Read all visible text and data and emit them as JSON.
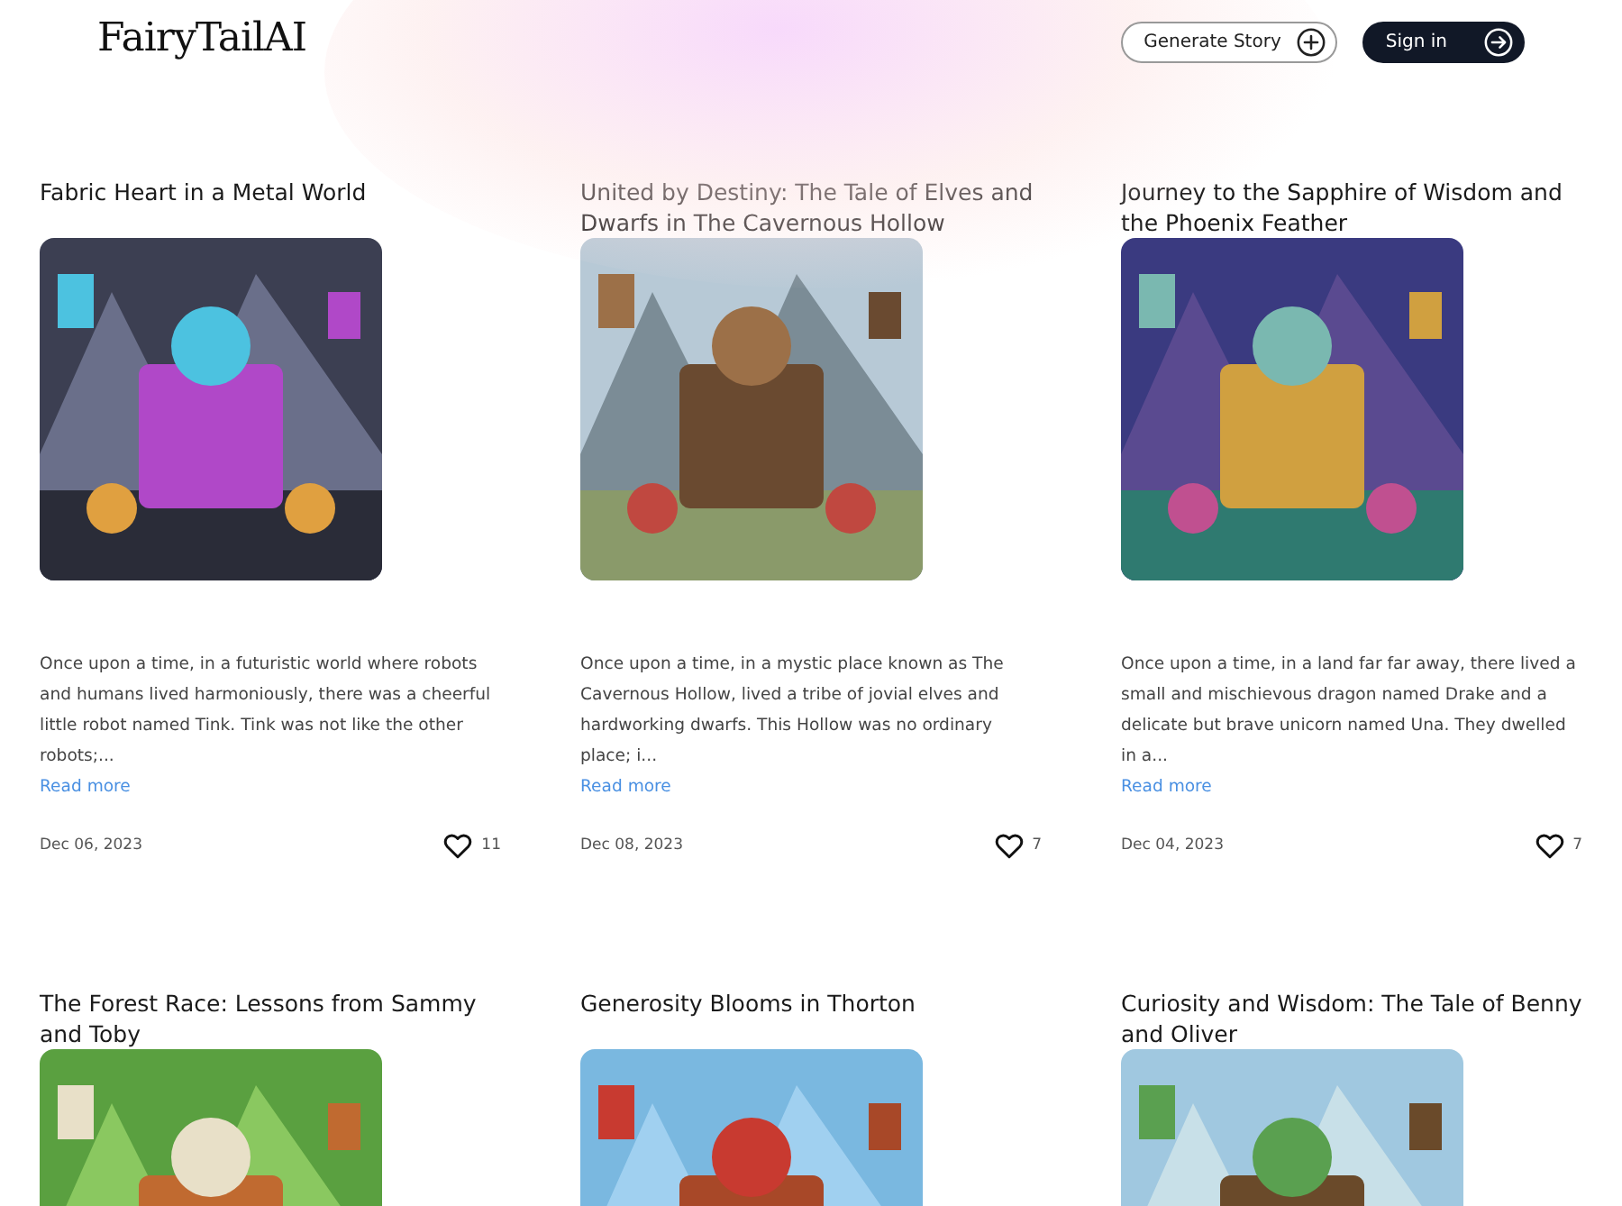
{
  "header": {
    "logo": "FairyTailAI",
    "buttons": [
      {
        "label": "Generate Story",
        "kind": "outline"
      },
      {
        "label": "Sign in",
        "kind": "dark"
      }
    ]
  },
  "stories": [
    {
      "title": "Fabric Heart in a Metal World",
      "excerpt": "Once upon a time, in a futuristic world where robots and humans lived harmoniously, there was a cheerful little robot named Tink. Tink was not like the other robots;...",
      "link": "Read more",
      "date": "Dec 06, 2023",
      "likes": "11"
    },
    {
      "title": "United by Destiny: The Tale of Elves and Dwarfs in The Cavernous Hollow",
      "excerpt": "Once upon a time, in a mystic place known as The Cavernous Hollow, lived a tribe of jovial elves and hardworking dwarfs. This Hollow was no ordinary place; i...",
      "link": "Read more",
      "date": "Dec 08, 2023",
      "likes": "7"
    },
    {
      "title": "Journey to the Sapphire of Wisdom and the Phoenix Feather",
      "excerpt": "Once upon a time, in a land far far away, there lived a small and mischievous dragon named Drake and a delicate but brave unicorn named Una. They dwelled in a...",
      "link": "Read more",
      "date": "Dec 04, 2023",
      "likes": "7"
    },
    {
      "title": "The Forest Race: Lessons from Sammy and Toby"
    },
    {
      "title": "Generosity Blooms in Thorton"
    },
    {
      "title": "Curiosity and Wisdom: The Tale of Benny and Oliver"
    }
  ]
}
